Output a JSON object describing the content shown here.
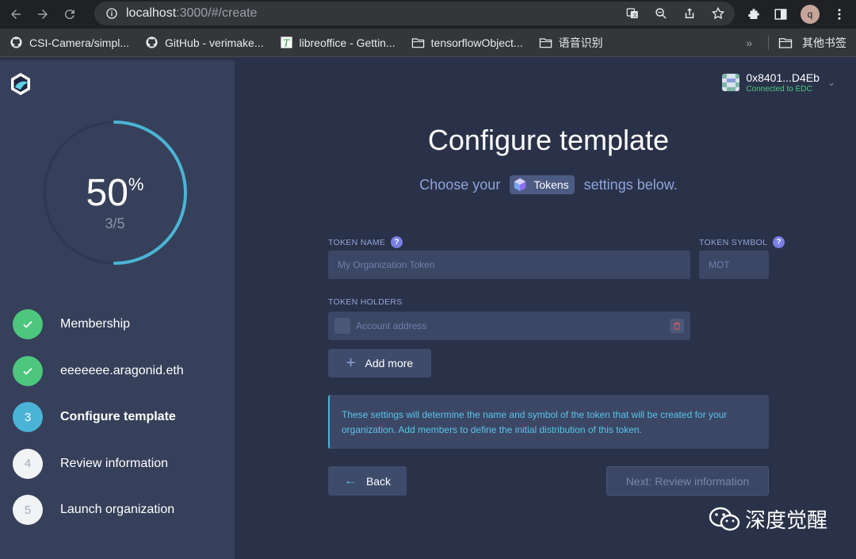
{
  "browser": {
    "url_host": "localhost",
    "url_path": ":3000/#/create",
    "profile_initial": "q"
  },
  "bookmarks": [
    {
      "label": "CSI-Camera/simpl...",
      "icon": "github-icon"
    },
    {
      "label": "GitHub - verimake...",
      "icon": "github-icon"
    },
    {
      "label": "libreoffice - Gettin...",
      "icon": "libreoffice-icon"
    },
    {
      "label": "tensorflowObject...",
      "icon": "folder-icon"
    },
    {
      "label": "语音识别",
      "icon": "folder-icon"
    }
  ],
  "bookmarks_overflow": "»",
  "other_bookmarks": "其他书签",
  "sidebar": {
    "progress_percent": "50",
    "percent_sign": "%",
    "progress_fraction": "3/5",
    "progress_value": 0.5,
    "steps": [
      {
        "label": "Membership",
        "state": "done",
        "marker": ""
      },
      {
        "label": "eeeeeee.aragonid.eth",
        "state": "done",
        "marker": ""
      },
      {
        "label": "Configure template",
        "state": "active",
        "marker": "3"
      },
      {
        "label": "Review information",
        "state": "todo",
        "marker": "4"
      },
      {
        "label": "Launch organization",
        "state": "todo",
        "marker": "5"
      }
    ]
  },
  "account": {
    "address": "0x8401...D4Eb",
    "status": "Connected to EDC"
  },
  "main": {
    "title": "Configure template",
    "subtitle_before": "Choose your",
    "template_name": "Tokens",
    "subtitle_after": "settings below.",
    "token_name_label": "TOKEN NAME",
    "token_name_placeholder": "My Organization Token",
    "token_symbol_label": "TOKEN SYMBOL",
    "token_symbol_placeholder": "MOT",
    "token_holders_label": "TOKEN HOLDERS",
    "account_placeholder": "Account address",
    "add_more": "Add more",
    "info": "These settings will determine the name and symbol of the token that will be created for your organization. Add members to define the initial distribution of this token.",
    "back": "Back",
    "next": "Next: Review information"
  },
  "watermark": "深度觉醒",
  "colors": {
    "sidebar_bg": "#36405a",
    "main_bg": "#2a3249",
    "done_green": "#4dc67e",
    "active_blue": "#4ab4d6",
    "accent_text": "#8fa3d9"
  }
}
